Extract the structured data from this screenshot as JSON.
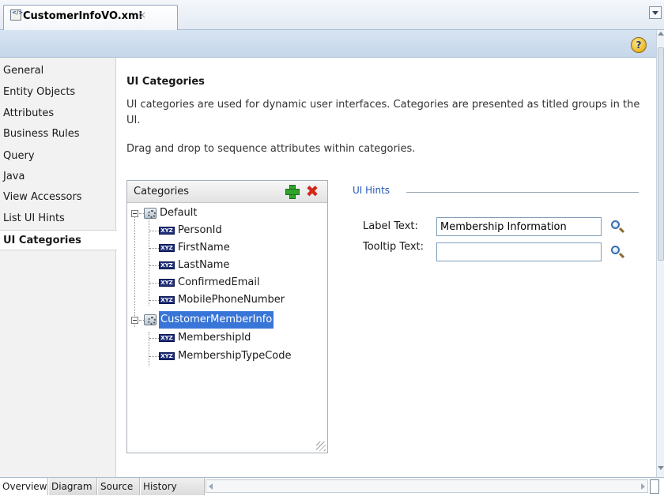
{
  "editor_tab": {
    "title": "CustomerInfoVO.xml",
    "close": "×",
    "icon": "xml-file-icon"
  },
  "help": {
    "label": "?"
  },
  "nav": {
    "items": [
      {
        "label": "General"
      },
      {
        "label": "Entity Objects"
      },
      {
        "label": "Attributes"
      },
      {
        "label": "Business Rules"
      },
      {
        "label": "Query"
      },
      {
        "label": "Java"
      },
      {
        "label": "View Accessors"
      },
      {
        "label": "List UI Hints"
      },
      {
        "label": "UI Categories"
      }
    ],
    "selected": "UI Categories"
  },
  "main": {
    "title": "UI Categories",
    "description": "UI categories are used for dynamic user interfaces. Categories are presented as titled groups in the UI.",
    "instruction": "Drag and drop to sequence attributes within categories."
  },
  "categories": {
    "header": "Categories",
    "attr_icon_text": "XYZ",
    "tree": [
      {
        "label": "Default",
        "children": [
          "PersonId",
          "FirstName",
          "LastName",
          "ConfirmedEmail",
          "MobilePhoneNumber"
        ]
      },
      {
        "label": "CustomerMemberInfo",
        "selected": true,
        "children": [
          "MembershipId",
          "MembershipTypeCode"
        ]
      }
    ]
  },
  "ui_hints": {
    "title": "UI Hints",
    "label_text": {
      "label": "Label Text:",
      "value": "Membership Information"
    },
    "tooltip_text": {
      "label": "Tooltip Text:",
      "value": ""
    }
  },
  "bottom_tabs": [
    {
      "label": "Overview",
      "active": true
    },
    {
      "label": "Diagram"
    },
    {
      "label": "Source"
    },
    {
      "label": "History"
    }
  ],
  "colors": {
    "accent": "#3875d7",
    "header_band": "#c6d7ea",
    "hints_title": "#2358b8",
    "add": "#2fa32b",
    "delete": "#d5281c"
  }
}
